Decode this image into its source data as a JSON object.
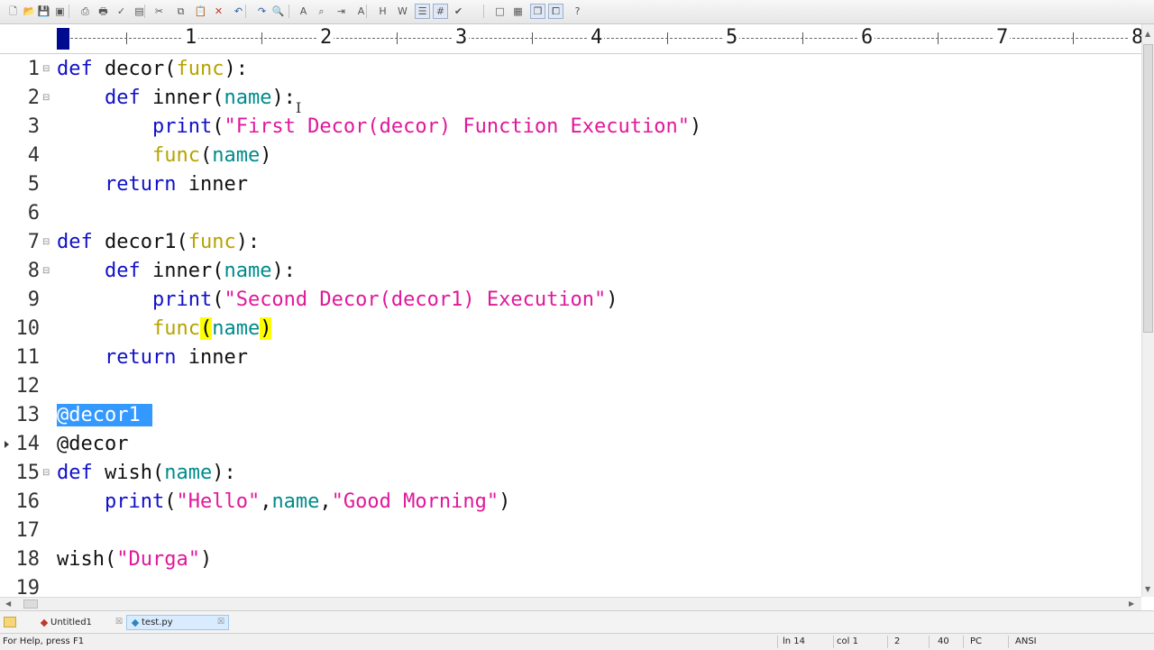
{
  "toolbar": {
    "icons": [
      "new-file-icon",
      "open-folder-icon",
      "save-icon",
      "save-all-icon",
      "print-preview-icon",
      "print-icon",
      "spell-check-icon",
      "document-icon",
      "cut-icon",
      "copy-icon",
      "paste-icon",
      "delete-icon",
      "undo-icon",
      "redo-icon",
      "find-icon",
      "replace-icon",
      "find-in-files-icon",
      "goto-icon",
      "font-icon",
      "hex-icon",
      "word-wrap-icon",
      "ruler-icon",
      "line-numbers-icon",
      "spell-icon",
      "window-icon",
      "tile-icon",
      "cascade-icon",
      "restore-icon",
      "help-icon"
    ]
  },
  "ruler": {
    "numbers": [
      "1",
      "2",
      "3",
      "4",
      "5",
      "6",
      "7",
      "8"
    ]
  },
  "editor": {
    "line_numbers": [
      "1",
      "2",
      "3",
      "4",
      "5",
      "6",
      "7",
      "8",
      "9",
      "10",
      "11",
      "12",
      "13",
      "14",
      "15",
      "16",
      "17",
      "18",
      "19"
    ],
    "lines": [
      [
        [
          "kw",
          "def "
        ],
        [
          "",
          "decor("
        ],
        [
          "fn",
          "func"
        ],
        [
          "",
          "):"
        ]
      ],
      [
        [
          "",
          "    "
        ],
        [
          "kw",
          "def "
        ],
        [
          "",
          "inner("
        ],
        [
          "var",
          "name"
        ],
        [
          "",
          "):"
        ]
      ],
      [
        [
          "",
          "        "
        ],
        [
          "kw",
          "print"
        ],
        [
          "",
          "("
        ],
        [
          "str",
          "\"First Decor(decor) Function Execution\""
        ],
        [
          "",
          ")"
        ]
      ],
      [
        [
          "",
          "        "
        ],
        [
          "fn",
          "func"
        ],
        [
          "",
          "("
        ],
        [
          "var",
          "name"
        ],
        [
          "",
          ")"
        ]
      ],
      [
        [
          "",
          "    "
        ],
        [
          "kw",
          "return"
        ],
        [
          "",
          " inner"
        ]
      ],
      [],
      [
        [
          "kw",
          "def "
        ],
        [
          "",
          "decor1("
        ],
        [
          "fn",
          "func"
        ],
        [
          "",
          "):"
        ]
      ],
      [
        [
          "",
          "    "
        ],
        [
          "kw",
          "def "
        ],
        [
          "",
          "inner("
        ],
        [
          "var",
          "name"
        ],
        [
          "",
          "):"
        ]
      ],
      [
        [
          "",
          "        "
        ],
        [
          "kw",
          "print"
        ],
        [
          "",
          "("
        ],
        [
          "str",
          "\"Second Decor(decor1) Execution\""
        ],
        [
          "",
          ")"
        ]
      ],
      [
        [
          "",
          "        "
        ],
        [
          "fn",
          "func"
        ],
        [
          "hl",
          "("
        ],
        [
          "var",
          "name"
        ],
        [
          "hl",
          ")"
        ]
      ],
      [
        [
          "",
          "    "
        ],
        [
          "kw",
          "return"
        ],
        [
          "",
          " inner"
        ]
      ],
      [],
      [
        [
          "sel",
          "@decor1 "
        ]
      ],
      [
        [
          "",
          "@decor"
        ]
      ],
      [
        [
          "kw",
          "def "
        ],
        [
          "",
          "wish("
        ],
        [
          "var",
          "name"
        ],
        [
          "",
          "):"
        ]
      ],
      [
        [
          "",
          "    "
        ],
        [
          "kw",
          "print"
        ],
        [
          "",
          "("
        ],
        [
          "str",
          "\"Hello\""
        ],
        [
          "",
          ","
        ],
        [
          "var",
          "name"
        ],
        [
          "",
          ","
        ],
        [
          "str",
          "\"Good Morning\""
        ],
        [
          "",
          ")"
        ]
      ],
      [],
      [
        [
          "",
          "wish("
        ],
        [
          "str",
          "\"Durga\""
        ],
        [
          "",
          ")"
        ]
      ],
      []
    ],
    "fold_lines": [
      1,
      2,
      7,
      8,
      15
    ],
    "bookmark_line": 14,
    "colors": {
      "keyword": "#1010c8",
      "function": "#b5a400",
      "variable": "#008b8b",
      "string": "#e0189a",
      "selection": "#3399ff",
      "bracket_match": "#ffff00"
    }
  },
  "tabs": [
    {
      "label": "Untitled1",
      "active": false
    },
    {
      "label": "test.py",
      "active": true
    }
  ],
  "statusbar": {
    "help": "For Help, press F1",
    "line": "ln 14",
    "col": "col 1",
    "field3": "2",
    "field4": "40",
    "mode": "PC",
    "encoding": "ANSI"
  }
}
